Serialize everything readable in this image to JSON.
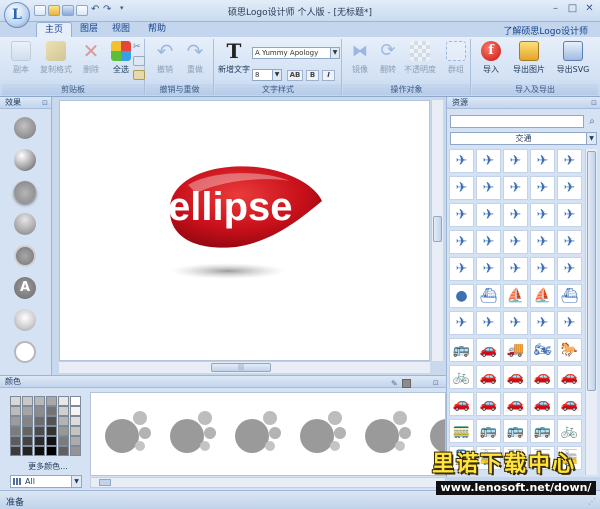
{
  "window": {
    "title": "硕思Logo设计师 个人版 - [无标题*]",
    "controls": [
      "–",
      "□",
      "✕"
    ]
  },
  "tabs": [
    "主页",
    "图层",
    "视图",
    "帮助"
  ],
  "help_link": "了解硕思Logo设计师",
  "ribbon": {
    "clipboard": {
      "label": "剪贴板",
      "buttons": [
        "副本",
        "复制格式",
        "删除",
        "全选"
      ]
    },
    "undo": {
      "label": "撤销与重做",
      "buttons": [
        "撤销",
        "重做"
      ]
    },
    "text": {
      "label": "文字样式",
      "new_text": "新增文字",
      "font": "A Yummy Apology",
      "size": "8",
      "format": [
        "AB",
        "B",
        "I"
      ]
    },
    "operate": {
      "label": "操作对象",
      "buttons": [
        "镜像",
        "翻转",
        "不透明度",
        "群组"
      ]
    },
    "io": {
      "label": "导入及导出",
      "buttons": [
        "导入",
        "导出图片",
        "导出SVG"
      ]
    }
  },
  "effects": {
    "title": "效果"
  },
  "canvas": {
    "logo_text": "ellipse"
  },
  "resources": {
    "title": "资源",
    "search_placeholder": "",
    "category": "交通"
  },
  "colors": {
    "title": "颜色",
    "more_colors": "更多颜色...",
    "palette": "All"
  },
  "status": {
    "text": "准备"
  },
  "watermark": {
    "cn": "里诺下载中心",
    "url": "www.lenosoft.net/down/"
  },
  "theme": {
    "accent": "#15428b",
    "logo_red": "#c8101a"
  }
}
